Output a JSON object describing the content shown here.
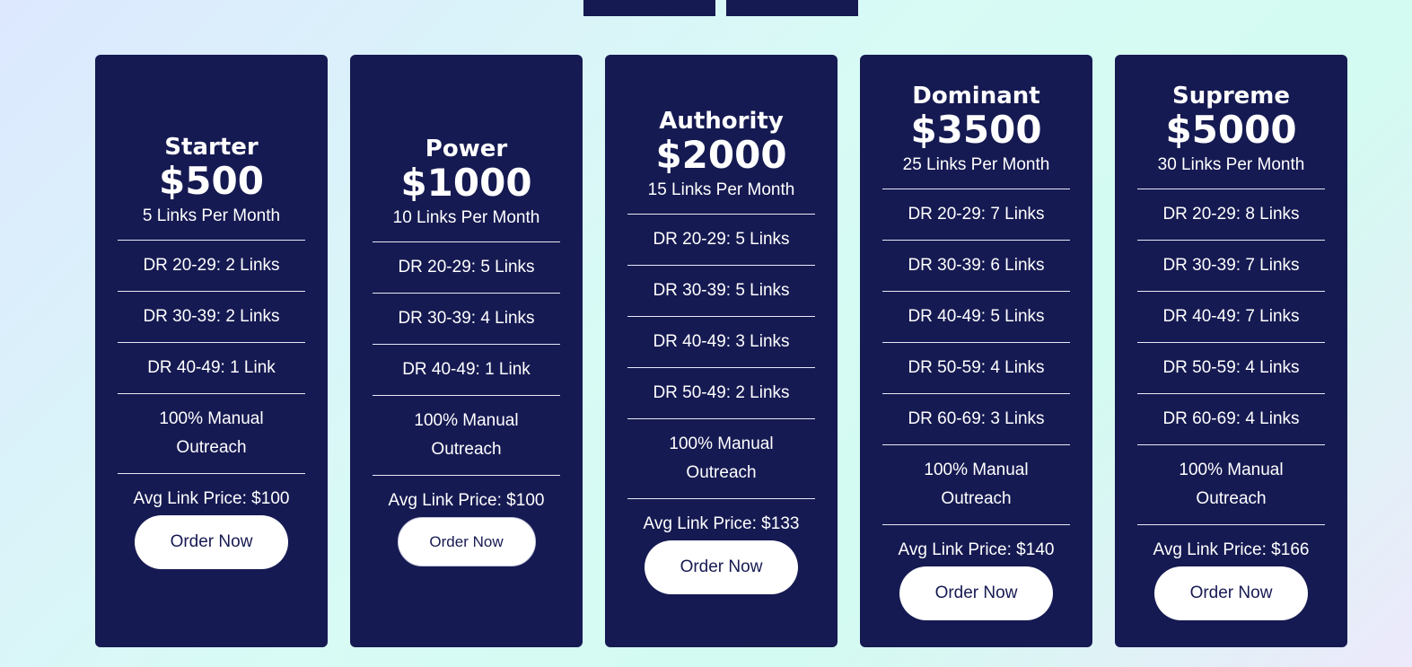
{
  "plans": [
    {
      "name": "Starter",
      "price": "$500",
      "links_per_month": "5 Links Per Month",
      "features": [
        "DR 20-29: 2 Links",
        "DR 30-39: 2 Links",
        "DR 40-49: 1 Link",
        "100% Manual Outreach"
      ],
      "avg_price": "Avg Link Price: $100",
      "cta": "Order Now"
    },
    {
      "name": "Power",
      "price": "$1000",
      "links_per_month": "10 Links Per Month",
      "features": [
        "DR 20-29: 5 Links",
        "DR 30-39: 4 Links",
        "DR 40-49: 1 Link",
        "100% Manual Outreach"
      ],
      "avg_price": "Avg Link Price: $100",
      "cta": "Order Now"
    },
    {
      "name": "Authority",
      "price": "$2000",
      "links_per_month": "15 Links Per Month",
      "features": [
        "DR 20-29: 5 Links",
        "DR 30-39: 5 Links",
        "DR 40-49: 3 Links",
        "DR 50-49: 2 Links",
        "100% Manual Outreach"
      ],
      "avg_price": "Avg Link Price: $133",
      "cta": "Order Now"
    },
    {
      "name": "Dominant",
      "price": "$3500",
      "links_per_month": "25 Links Per Month",
      "features": [
        "DR 20-29: 7 Links",
        "DR 30-39: 6 Links",
        "DR 40-49: 5 Links",
        "DR 50-59: 4 Links",
        "DR 60-69: 3 Links",
        "100% Manual Outreach"
      ],
      "avg_price": "Avg Link Price: $140",
      "cta": "Order Now"
    },
    {
      "name": "Supreme",
      "price": "$5000",
      "links_per_month": "30 Links Per Month",
      "features": [
        "DR 20-29: 8 Links",
        "DR 30-39: 7 Links",
        "DR 40-49: 7 Links",
        "DR 50-59: 4 Links",
        "DR 60-69: 4 Links",
        "100% Manual Outreach"
      ],
      "avg_price": "Avg Link Price: $166",
      "cta": "Order Now"
    }
  ],
  "colors": {
    "card_bg": "#161a52",
    "button_bg": "#ffffff",
    "button_text": "#161a52"
  }
}
